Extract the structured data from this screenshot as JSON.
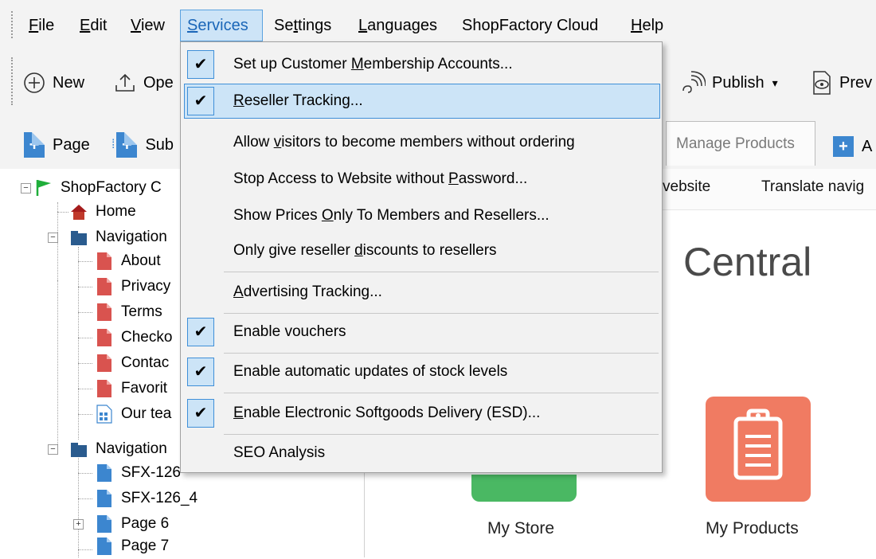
{
  "menubar": {
    "items": [
      {
        "pre": "",
        "u": "F",
        "post": "ile"
      },
      {
        "pre": "",
        "u": "E",
        "post": "dit"
      },
      {
        "pre": "",
        "u": "V",
        "post": "iew"
      },
      {
        "pre": "",
        "u": "S",
        "post": "ervices"
      },
      {
        "pre": "Se",
        "u": "t",
        "post": "tings"
      },
      {
        "pre": "",
        "u": "L",
        "post": "anguages"
      },
      {
        "pre": "ShopFactory Cloud",
        "u": "",
        "post": ""
      },
      {
        "pre": "",
        "u": "H",
        "post": "elp"
      }
    ]
  },
  "toolbar": {
    "new_label": "New",
    "open_label": "Ope",
    "publish_label": "Publish",
    "preview_label": "Prev"
  },
  "toolbar2": {
    "page_label": "Page",
    "sub_label": "Sub",
    "manage_products_tab": "Manage Products",
    "add_label": "A"
  },
  "subnav": {
    "website_label": "vebsite",
    "translate_label": "Translate navig"
  },
  "tree": {
    "root": "ShopFactory C",
    "home": "Home",
    "nav1": "Navigation",
    "nav1_children": [
      "About",
      "Privacy",
      "Terms",
      "Checko",
      "Contac",
      "Favorit",
      "Our tea"
    ],
    "nav2": "Navigation",
    "nav2_children": [
      "SFX-126",
      "SFX-126_4",
      "Page 6",
      "Page 7"
    ]
  },
  "content": {
    "heading": "Central",
    "tile_store": "My Store",
    "tile_products": "My Products"
  },
  "dropdown": {
    "items": [
      {
        "pre": "Set up Customer ",
        "u": "M",
        "post": "embership Accounts...",
        "checked": true
      },
      {
        "pre": "",
        "u": "R",
        "post": "eseller Tracking...",
        "checked": true,
        "highlight": true
      },
      {
        "pre": "Allow ",
        "u": "v",
        "post": "isitors to become members without ordering",
        "checked": false
      },
      {
        "pre": "Stop Access to Website without ",
        "u": "P",
        "post": "assword...",
        "checked": false
      },
      {
        "pre": "Show Prices ",
        "u": "O",
        "post": "nly To Members and Resellers...",
        "checked": false
      },
      {
        "pre": "Only give reseller ",
        "u": "d",
        "post": "iscounts to resellers",
        "checked": false
      },
      {
        "pre": "",
        "u": "A",
        "post": "dvertising Tracking...",
        "checked": false
      },
      {
        "pre": "Enable vouchers",
        "u": "",
        "post": "",
        "checked": true
      },
      {
        "pre": "Enable automatic updates of stock levels",
        "u": "",
        "post": "",
        "checked": true
      },
      {
        "pre": "",
        "u": "E",
        "post": "nable Electronic Softgoods Delivery (ESD)...",
        "checked": true
      },
      {
        "pre": "SEO Analysis",
        "u": "",
        "post": "",
        "checked": false
      }
    ],
    "check_glyph": "✔"
  },
  "colors": {
    "accent": "#3f8fd8",
    "highlight_bg": "#cce4f7",
    "menu_bg": "#f2f2f2",
    "products_tile": "#f07b62",
    "store_tile": "#4ab863",
    "folder": "#2a5b8e",
    "page_icon": "#d9534f",
    "flag": "#1fae3a"
  },
  "icons": {
    "new": "circle-plus-icon",
    "open": "upload-arrow-icon",
    "publish": "broadcast-icon",
    "preview": "preview-eye-icon"
  }
}
